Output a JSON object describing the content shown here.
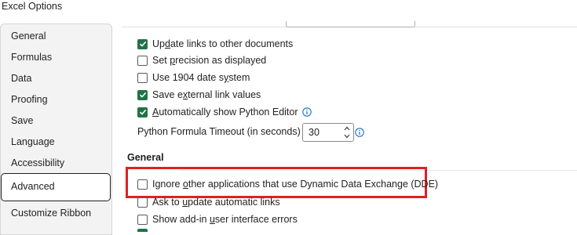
{
  "window": {
    "title": "Excel Options"
  },
  "sidebar": {
    "items": [
      {
        "label": "General"
      },
      {
        "label": "Formulas"
      },
      {
        "label": "Data"
      },
      {
        "label": "Proofing"
      },
      {
        "label": "Save"
      },
      {
        "label": "Language"
      },
      {
        "label": "Accessibility"
      },
      {
        "label": "Advanced",
        "selected": true
      },
      {
        "label": "Customize Ribbon"
      }
    ]
  },
  "calc_options": {
    "update_links": {
      "pre": "Up",
      "ul": "d",
      "post": "ate links to other documents",
      "checked": true
    },
    "set_precision": {
      "pre": "Set ",
      "ul": "p",
      "post": "recision as displayed",
      "checked": false
    },
    "date_1904": {
      "pre": "Use 1904 date s",
      "ul": "y",
      "post": "stem",
      "checked": false
    },
    "save_ext_links": {
      "pre": "Save e",
      "ul": "x",
      "post": "ternal link values",
      "checked": true
    },
    "python_editor": {
      "pre": "",
      "ul": "A",
      "post": "utomatically show Python Editor",
      "checked": true
    },
    "python_timeout": {
      "label": "Python Formula Timeout (in seconds)",
      "value": "30"
    }
  },
  "general_section": {
    "heading": "General",
    "ignore_dde": {
      "pre": "Ignore ",
      "ul": "o",
      "post": "ther applications that use Dynamic Data Exchange (DDE)",
      "checked": false
    },
    "ask_update": {
      "pre": "Ask to ",
      "ul": "u",
      "post": "pdate automatic links",
      "checked": false
    },
    "show_addin_errors": {
      "pre": "Show add-in ",
      "ul": "u",
      "post": "ser interface errors",
      "checked": false
    }
  },
  "colors": {
    "accent": "#217346",
    "highlight": "#e02020"
  }
}
